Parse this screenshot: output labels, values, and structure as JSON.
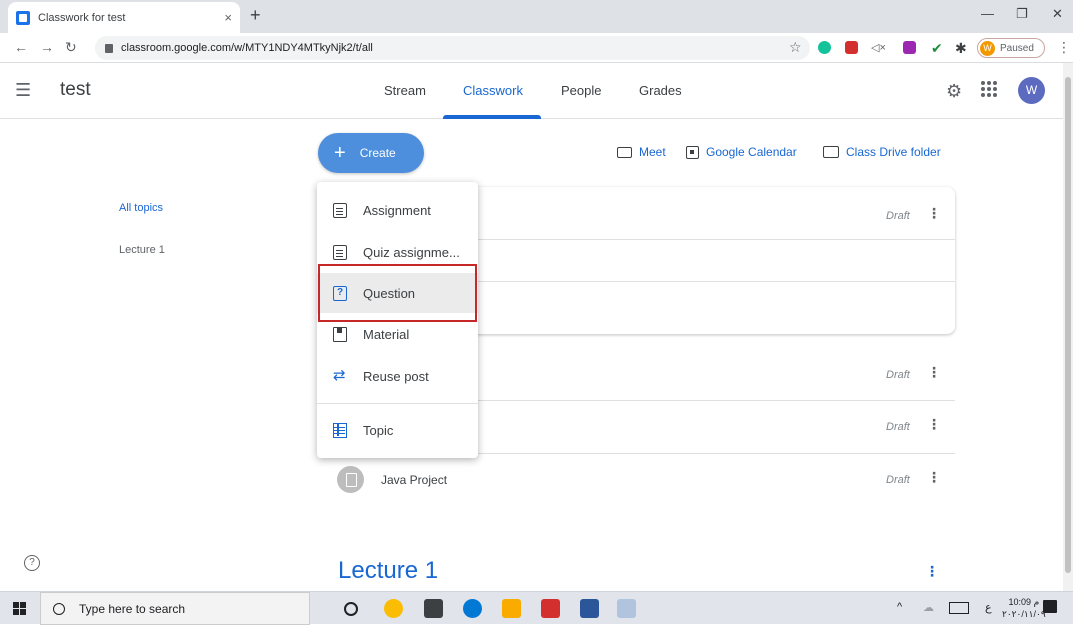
{
  "browser": {
    "tab_title": "Classwork for test",
    "tab_close": "×",
    "new_tab": "+",
    "url": "classroom.google.com/w/MTY1NDY4MTkyNjk2/t/all",
    "profile_initial": "W",
    "profile_status": "Paused",
    "menu_glyph": "⋮"
  },
  "app": {
    "class_name": "test",
    "nav_tabs": [
      "Stream",
      "Classwork",
      "People",
      "Grades"
    ],
    "active_tab": "Classwork",
    "avatar_initial": "W"
  },
  "toolbar": {
    "create_label": "Create",
    "meet_label": "Meet",
    "calendar_label": "Google Calendar",
    "drive_label": "Class Drive folder"
  },
  "topics": {
    "all": "All topics",
    "items": [
      "Lecture 1"
    ]
  },
  "create_menu": {
    "items": [
      "Assignment",
      "Quiz assignme...",
      "Question",
      "Material",
      "Reuse post",
      "Topic"
    ],
    "highlighted": "Question"
  },
  "classwork": {
    "status": "Draft",
    "items": [
      {
        "title": "",
        "status": "Draft"
      },
      {
        "title": "",
        "status": "Draft"
      },
      {
        "title": "",
        "status": "Draft"
      },
      {
        "title": "Java Project",
        "status": "Draft"
      }
    ],
    "section_heading": "Lecture 1"
  },
  "help_glyph": "?",
  "taskbar": {
    "search_placeholder": "Type here to search",
    "time": "10:09 م",
    "date": "٢٠٢٠/١١/٠٩",
    "lang": "ع"
  },
  "colors": {
    "accent": "#1967d2",
    "create_button": "#4d8fdc",
    "highlight_box": "#c62828"
  }
}
